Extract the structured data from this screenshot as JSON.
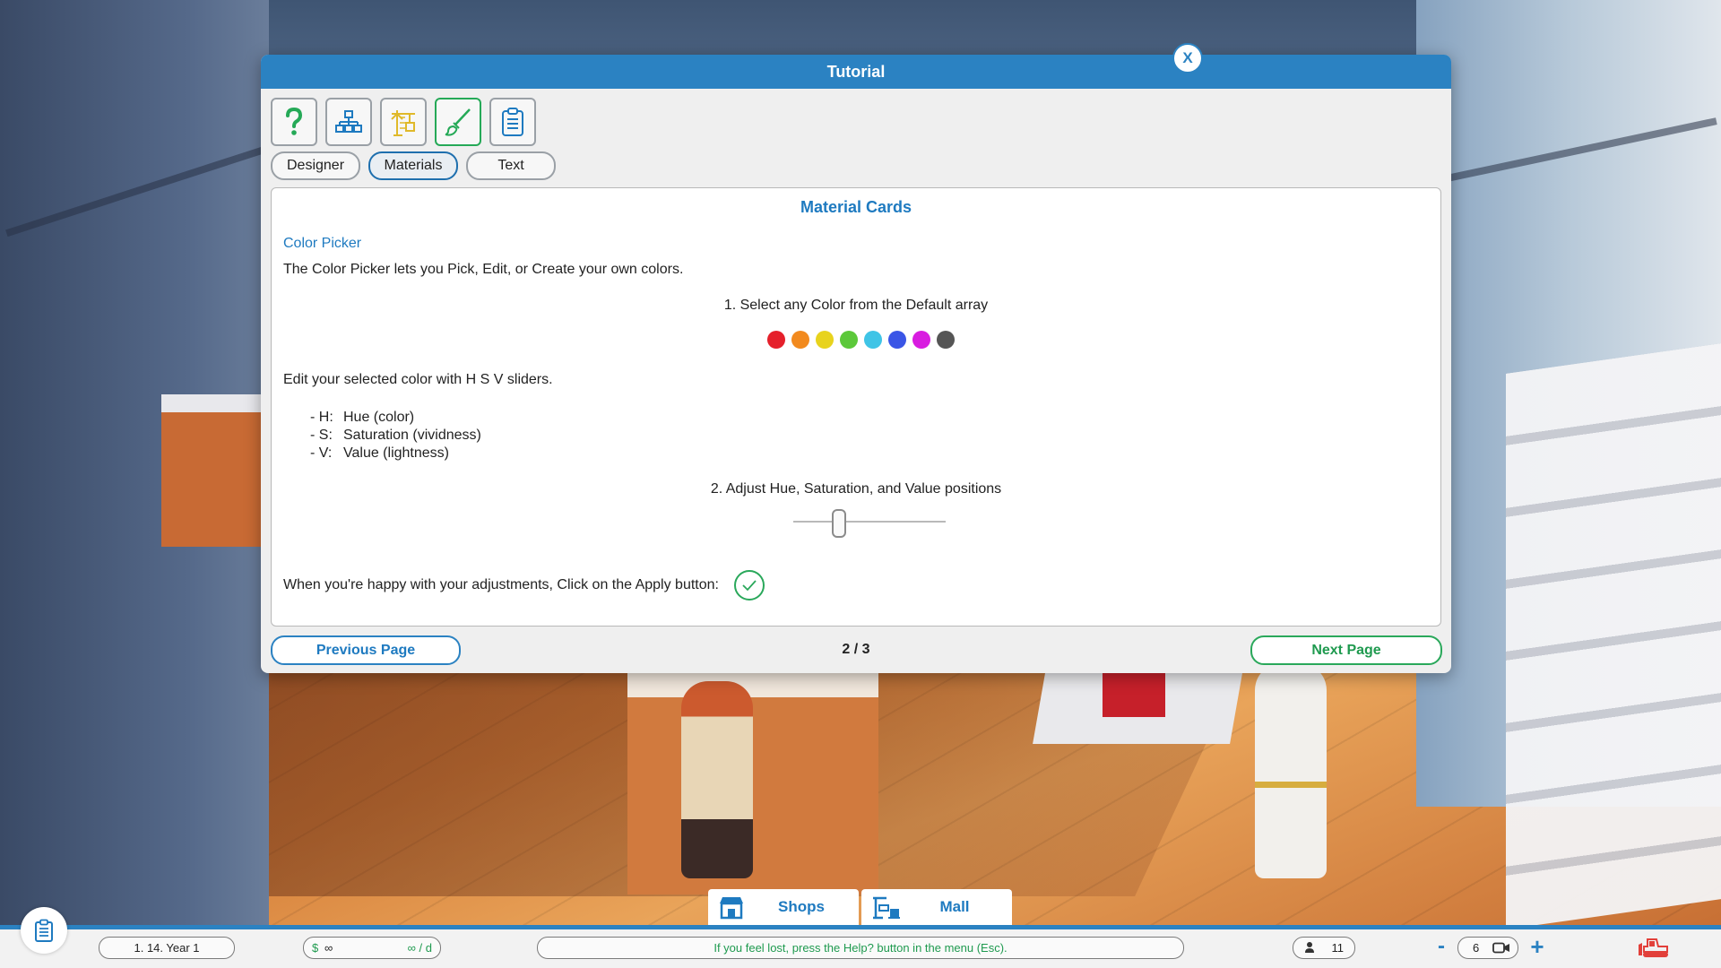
{
  "dialog": {
    "title": "Tutorial",
    "close_label": "X",
    "icon_tabs": [
      {
        "icon": "help-question-icon",
        "active": false
      },
      {
        "icon": "hierarchy-icon",
        "active": false
      },
      {
        "icon": "crane-icon",
        "active": false
      },
      {
        "icon": "paintbrush-icon",
        "active": true
      },
      {
        "icon": "clipboard-icon",
        "active": false
      }
    ],
    "sub_tabs": [
      "Designer",
      "Materials",
      "Text"
    ],
    "active_sub_tab": "Materials",
    "content": {
      "title": "Material Cards",
      "section_title": "Color Picker",
      "intro": "The Color Picker lets you Pick, Edit, or Create your own colors.",
      "step1": "1. Select any Color from the Default array",
      "swatches": [
        "#e5202b",
        "#f28a1e",
        "#e8d31d",
        "#5cc83a",
        "#3fc4e6",
        "#3a55e6",
        "#d81ce0",
        "#555555"
      ],
      "edit_text": "Edit your selected color with H S V sliders.",
      "hsv": [
        {
          "key": "- H:",
          "desc": "Hue (color)"
        },
        {
          "key": "- S:",
          "desc": "Saturation (vividness)"
        },
        {
          "key": "- V:",
          "desc": "Value (lightness)"
        }
      ],
      "step2": "2. Adjust Hue, Saturation, and Value positions",
      "slider_value": 0.3,
      "apply_text": "When you're happy with your adjustments, Click on the Apply button:"
    },
    "prev_label": "Previous Page",
    "next_label": "Next Page",
    "page_indicator": "2 / 3"
  },
  "bottom_tabs": [
    {
      "label": "Shops",
      "icon": "shop-icon"
    },
    {
      "label": "Mall",
      "icon": "mall-icon"
    }
  ],
  "statusbar": {
    "date": "1. 14.  Year 1",
    "currency": "$",
    "money": "∞",
    "rate": "∞ / d",
    "help": "If you feel lost, press the Help? button in the menu (Esc).",
    "population": "11",
    "minus": "-",
    "speed": "6",
    "plus": "+"
  },
  "colors": {
    "accent_blue": "#2b82c2",
    "accent_green": "#2aa85b"
  }
}
